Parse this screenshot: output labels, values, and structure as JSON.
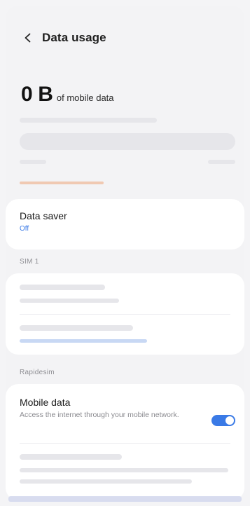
{
  "header": {
    "title": "Data usage"
  },
  "usage": {
    "value": "0",
    "unit": "B",
    "caption": "of mobile data"
  },
  "data_saver": {
    "title": "Data saver",
    "status": "Off"
  },
  "sim_section": {
    "label": "SIM 1"
  },
  "carrier_section": {
    "label": "Rapidesim"
  },
  "mobile_data": {
    "title": "Mobile data",
    "description": "Access the internet through your mobile network.",
    "enabled": true
  },
  "colors": {
    "accent": "#3a7ae6",
    "usage_bar": "#f0c9b2",
    "placeholder": "#e6e6ea"
  },
  "icons": {
    "back": "chevron-left-icon"
  }
}
